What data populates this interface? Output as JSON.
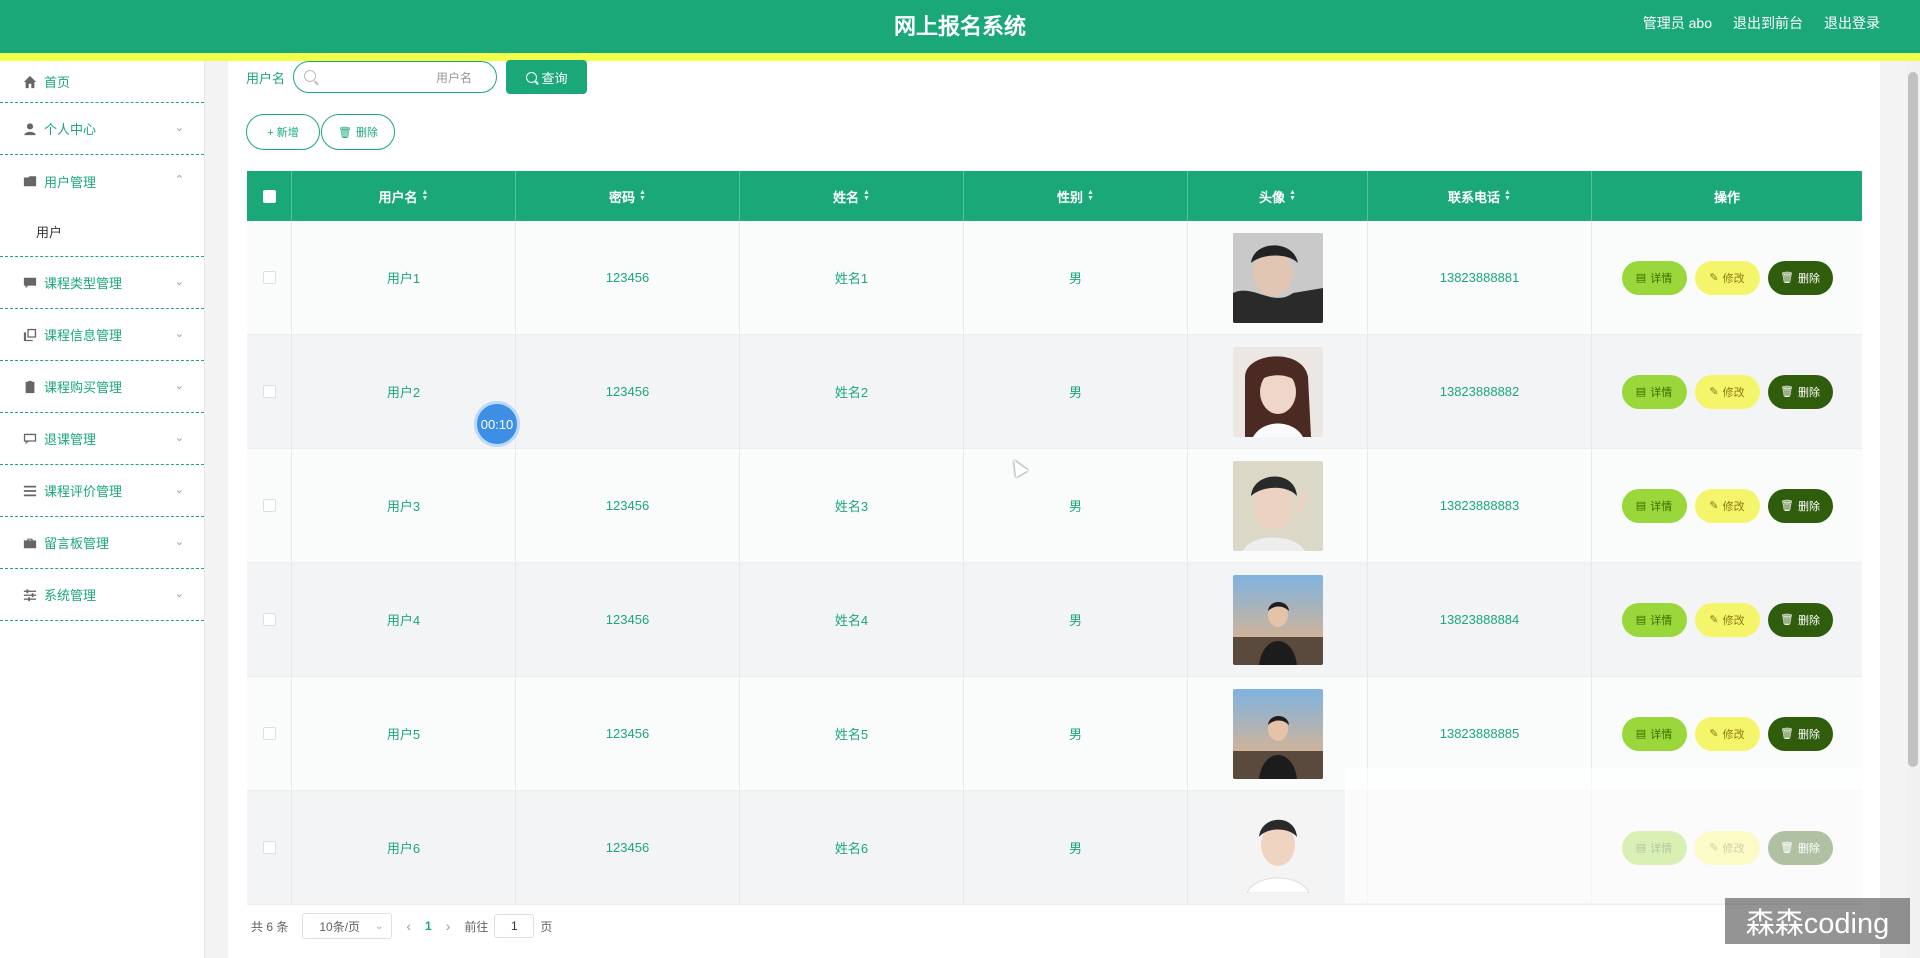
{
  "header": {
    "title": "网上报名系统",
    "admin_label": "管理员 abo",
    "front_link": "退出到前台",
    "logout_link": "退出登录"
  },
  "sidebar": {
    "items": [
      {
        "label": "首页",
        "icon": "home-icon"
      },
      {
        "label": "个人中心",
        "icon": "user-icon"
      },
      {
        "label": "用户管理",
        "icon": "folder-icon"
      },
      {
        "label": "课程类型管理",
        "icon": "chat-icon"
      },
      {
        "label": "课程信息管理",
        "icon": "copy-icon"
      },
      {
        "label": "课程购买管理",
        "icon": "clipboard-icon"
      },
      {
        "label": "退课管理",
        "icon": "message-icon"
      },
      {
        "label": "课程评价管理",
        "icon": "list-icon"
      },
      {
        "label": "留言板管理",
        "icon": "briefcase-icon"
      },
      {
        "label": "系统管理",
        "icon": "sliders-icon"
      }
    ],
    "submenu_user": "用户"
  },
  "search": {
    "label": "用户名",
    "placeholder": "用户名",
    "button": "查询"
  },
  "actions": {
    "add": "+ 新增",
    "delete": "删除"
  },
  "table": {
    "headers": [
      "用户名",
      "密码",
      "姓名",
      "性别",
      "头像",
      "联系电话",
      "操作"
    ],
    "rows": [
      {
        "username": "用户1",
        "password": "123456",
        "name": "姓名1",
        "gender": "男",
        "phone": "13823888881"
      },
      {
        "username": "用户2",
        "password": "123456",
        "name": "姓名2",
        "gender": "男",
        "phone": "13823888882"
      },
      {
        "username": "用户3",
        "password": "123456",
        "name": "姓名3",
        "gender": "男",
        "phone": "13823888883"
      },
      {
        "username": "用户4",
        "password": "123456",
        "name": "姓名4",
        "gender": "男",
        "phone": "13823888884"
      },
      {
        "username": "用户5",
        "password": "123456",
        "name": "姓名5",
        "gender": "男",
        "phone": "13823888885"
      },
      {
        "username": "用户6",
        "password": "123456",
        "name": "姓名6",
        "gender": "男",
        "phone": ""
      }
    ],
    "op_detail": "详情",
    "op_edit": "修改",
    "op_delete": "删除"
  },
  "pagination": {
    "total": "共 6 条",
    "page_size": "10条/页",
    "current_page": "1",
    "goto_prefix": "前往",
    "goto_value": "1",
    "goto_suffix": "页"
  },
  "overlay": {
    "timer": "00:10",
    "watermark": "森森coding"
  },
  "colors": {
    "primary": "#1ba878",
    "stripe": "#f2ff4a",
    "detail_btn": "#9ad73a",
    "edit_btn": "#f5f56b",
    "delete_btn": "#2f5d0b"
  }
}
